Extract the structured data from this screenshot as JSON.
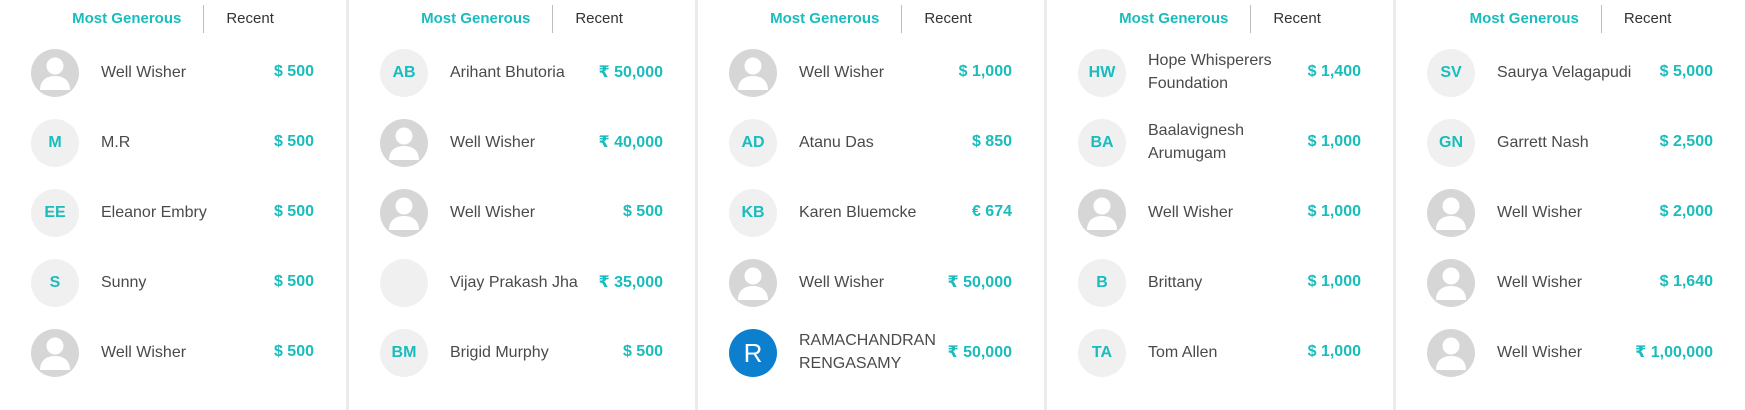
{
  "colors": {
    "accent": "#1abcbc",
    "avatar_blue": "#0c7fcf",
    "avatar_bg": "#f0f0f0"
  },
  "panels": [
    {
      "tabs": {
        "active": "Most Generous",
        "inactive": "Recent"
      },
      "donors": [
        {
          "name": "Well Wisher",
          "amount": "$ 500",
          "avatar": "",
          "avatar_type": "person"
        },
        {
          "name": "M.R",
          "amount": "$ 500",
          "avatar": "M",
          "avatar_type": "initials"
        },
        {
          "name": "Eleanor Embry",
          "amount": "$ 500",
          "avatar": "EE",
          "avatar_type": "initials"
        },
        {
          "name": "Sunny",
          "amount": "$ 500",
          "avatar": "S",
          "avatar_type": "initials"
        },
        {
          "name": "Well Wisher",
          "amount": "$ 500",
          "avatar": "",
          "avatar_type": "person"
        }
      ]
    },
    {
      "tabs": {
        "active": "Most Generous",
        "inactive": "Recent"
      },
      "donors": [
        {
          "name": "Arihant Bhutoria",
          "amount": "₹ 50,000",
          "avatar": "AB",
          "avatar_type": "initials"
        },
        {
          "name": "Well Wisher",
          "amount": "₹ 40,000",
          "avatar": "",
          "avatar_type": "person"
        },
        {
          "name": "Well Wisher",
          "amount": "$ 500",
          "avatar": "",
          "avatar_type": "person"
        },
        {
          "name": "Vijay Prakash Jha",
          "amount": "₹ 35,000",
          "avatar": "",
          "avatar_type": "blank"
        },
        {
          "name": "Brigid Murphy",
          "amount": "$ 500",
          "avatar": "BM",
          "avatar_type": "initials"
        }
      ]
    },
    {
      "tabs": {
        "active": "Most Generous",
        "inactive": "Recent"
      },
      "donors": [
        {
          "name": "Well Wisher",
          "amount": "$ 1,000",
          "avatar": "",
          "avatar_type": "person"
        },
        {
          "name": "Atanu Das",
          "amount": "$ 850",
          "avatar": "AD",
          "avatar_type": "initials"
        },
        {
          "name": "Karen Bluemcke",
          "amount": "€ 674",
          "avatar": "KB",
          "avatar_type": "initials"
        },
        {
          "name": "Well Wisher",
          "amount": "₹ 50,000",
          "avatar": "",
          "avatar_type": "person"
        },
        {
          "name": "RAMACHANDRAN RENGASAMY",
          "amount": "₹ 50,000",
          "avatar": "R",
          "avatar_type": "blue"
        }
      ]
    },
    {
      "tabs": {
        "active": "Most Generous",
        "inactive": "Recent"
      },
      "donors": [
        {
          "name": "Hope Whisperers Foundation",
          "amount": "$ 1,400",
          "avatar": "HW",
          "avatar_type": "initials"
        },
        {
          "name": "Baalavignesh Arumugam",
          "amount": "$ 1,000",
          "avatar": "BA",
          "avatar_type": "initials"
        },
        {
          "name": "Well Wisher",
          "amount": "$ 1,000",
          "avatar": "",
          "avatar_type": "person"
        },
        {
          "name": "Brittany",
          "amount": "$ 1,000",
          "avatar": "B",
          "avatar_type": "initials"
        },
        {
          "name": "Tom Allen",
          "amount": "$ 1,000",
          "avatar": "TA",
          "avatar_type": "initials"
        }
      ]
    },
    {
      "tabs": {
        "active": "Most Generous",
        "inactive": "Recent"
      },
      "donors": [
        {
          "name": "Saurya Velagapudi",
          "amount": "$ 5,000",
          "avatar": "SV",
          "avatar_type": "initials"
        },
        {
          "name": "Garrett Nash",
          "amount": "$ 2,500",
          "avatar": "GN",
          "avatar_type": "initials"
        },
        {
          "name": "Well Wisher",
          "amount": "$ 2,000",
          "avatar": "",
          "avatar_type": "person"
        },
        {
          "name": "Well Wisher",
          "amount": "$ 1,640",
          "avatar": "",
          "avatar_type": "person"
        },
        {
          "name": "Well Wisher",
          "amount": "₹ 1,00,000",
          "avatar": "",
          "avatar_type": "person"
        }
      ]
    }
  ]
}
